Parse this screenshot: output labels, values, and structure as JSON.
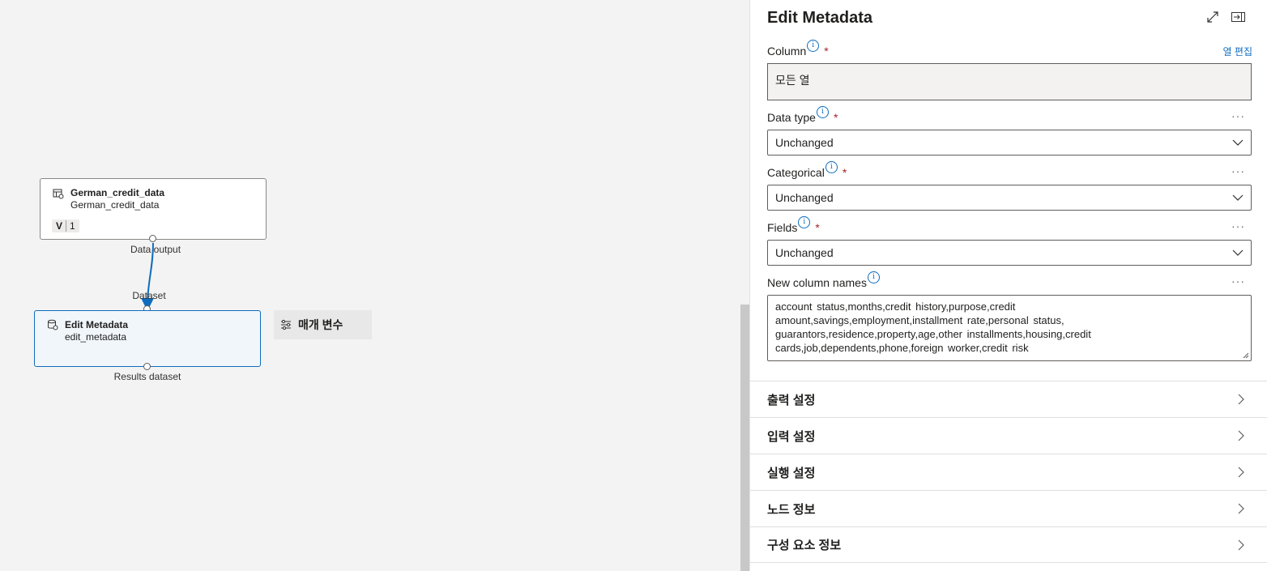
{
  "canvas": {
    "dataset_node": {
      "title": "German_credit_data",
      "subtitle": "German_credit_data",
      "version_label": "V",
      "version_number": "1",
      "output_port_label": "Data output"
    },
    "module_node": {
      "title": "Edit Metadata",
      "subtitle": "edit_metadata",
      "input_port_label": "Dataset",
      "output_port_label": "Results dataset"
    },
    "parameters_button": {
      "label": "매개 변수"
    }
  },
  "panel": {
    "title": "Edit Metadata",
    "icons": {
      "expand": "expand-icon",
      "dock": "dock-panel-icon"
    },
    "column": {
      "label": "Column",
      "required": "*",
      "edit_link": "열 편집",
      "value": "모든 열"
    },
    "data_type": {
      "label": "Data type",
      "required": "*",
      "value": "Unchanged",
      "more": "···"
    },
    "categorical": {
      "label": "Categorical",
      "required": "*",
      "value": "Unchanged",
      "more": "···"
    },
    "fields": {
      "label": "Fields",
      "required": "*",
      "value": "Unchanged",
      "more": "···"
    },
    "new_column_names": {
      "label": "New column names",
      "more": "···",
      "lines": [
        "account  status,months,credit  history,purpose,credit",
        "amount,savings,employment,installment  rate,personal  status,",
        "guarantors,residence,property,age,other  installments,housing,credit",
        "cards,job,dependents,phone,foreign  worker,credit  risk"
      ]
    },
    "sections": [
      "출력 설정",
      "입력 설정",
      "실행 설정",
      "노드 정보",
      "구성 요소 정보"
    ]
  },
  "colors": {
    "accent": "#0f6cbd",
    "required": "#a4262c",
    "canvas_bg": "#f3f3f3",
    "selected_node_bg": "#f1f6fb"
  }
}
